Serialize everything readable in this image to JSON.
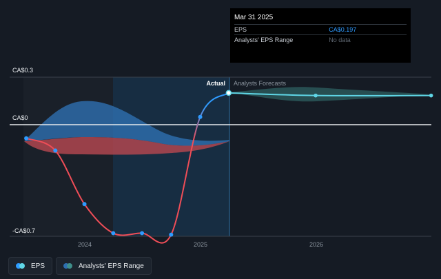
{
  "chart_data": {
    "type": "line",
    "y_tick_labels": [
      "CA$0.3",
      "CA$0",
      "-CA$0.7"
    ],
    "x_tick_labels": [
      "2024",
      "2025",
      "2026"
    ],
    "ylim": [
      -0.7,
      0.3
    ],
    "grid": false,
    "section_labels": {
      "actual": "Actual",
      "forecast": "Analysts Forecasts"
    },
    "series": [
      {
        "name": "EPS",
        "color": "#2f9bff",
        "x": [
          "2023-06-30",
          "2023-09-30",
          "2023-12-31",
          "2024-03-31",
          "2024-06-30",
          "2024-09-30",
          "2024-12-31",
          "2025-03-31"
        ],
        "values": [
          -0.1,
          -0.18,
          -0.53,
          -0.72,
          -0.72,
          -0.73,
          0.04,
          0.197
        ]
      },
      {
        "name": "EPS forecast",
        "color": "#5fd6e6",
        "x": [
          "2025-03-31",
          "2025-12-31",
          "2026-12-31"
        ],
        "values": [
          0.197,
          0.18,
          0.18
        ]
      }
    ],
    "analyst_range": {
      "name": "Analysts' EPS Range",
      "x": [
        "2025-03-31",
        "2026-12-31"
      ],
      "low": [
        0.197,
        0.18
      ],
      "high": [
        0.197,
        0.18
      ]
    },
    "region_bands": {
      "positive_color": "#2e6fb0",
      "negative_color": "#b0464f"
    },
    "past_highlight": [
      "2024-03-31",
      "2025-03-31"
    ]
  },
  "tooltip": {
    "date": "Mar 31 2025",
    "rows": [
      {
        "label": "EPS",
        "value": "CA$0.197"
      },
      {
        "label": "Analysts' EPS Range",
        "value": "No data"
      }
    ]
  },
  "legend": {
    "items": [
      {
        "label": "EPS",
        "colors": [
          "#2f9bff",
          "#5fd6e6"
        ]
      },
      {
        "label": "Analysts' EPS Range",
        "colors": [
          "#2e6fb0",
          "#3f8f8a"
        ]
      }
    ]
  }
}
